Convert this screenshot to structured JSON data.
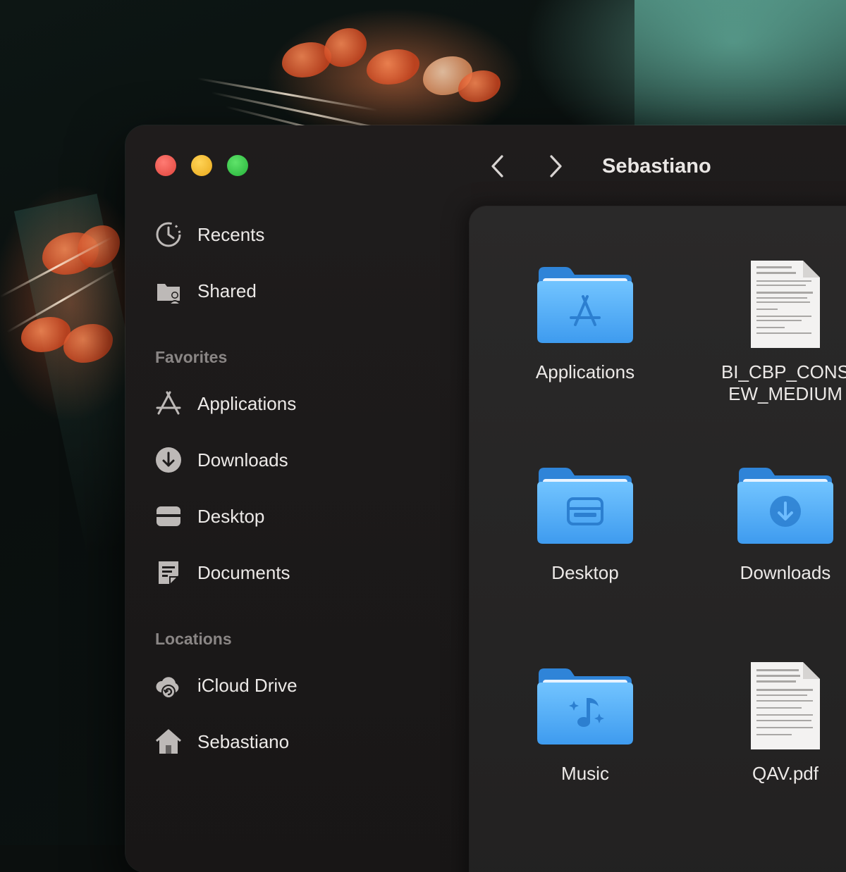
{
  "window": {
    "title": "Sebastiano",
    "nav_back_icon": "chevron-left-icon",
    "nav_forward_icon": "chevron-right-icon"
  },
  "sidebar": {
    "top_items": [
      {
        "label": "Recents",
        "icon": "clock-icon"
      },
      {
        "label": "Shared",
        "icon": "shared-folder-icon"
      }
    ],
    "favorites_header": "Favorites",
    "favorites": [
      {
        "label": "Applications",
        "icon": "app-store-icon"
      },
      {
        "label": "Downloads",
        "icon": "download-circle-icon"
      },
      {
        "label": "Desktop",
        "icon": "desktop-icon"
      },
      {
        "label": "Documents",
        "icon": "document-icon"
      }
    ],
    "locations_header": "Locations",
    "locations": [
      {
        "label": "iCloud Drive",
        "icon": "icloud-icon"
      },
      {
        "label": "Sebastiano",
        "icon": "home-icon"
      }
    ]
  },
  "files": [
    {
      "label": "Applications",
      "kind": "folder",
      "glyph": "app-store-icon"
    },
    {
      "label": "BI_CBP_CONS\nEW_MEDIUM",
      "kind": "document"
    },
    {
      "label": "Desktop",
      "kind": "folder",
      "glyph": "desktop-icon"
    },
    {
      "label": "Downloads",
      "kind": "folder",
      "glyph": "download-circle-icon"
    },
    {
      "label": "Music",
      "kind": "folder",
      "glyph": "music-note-icon"
    },
    {
      "label": "QAV.pdf",
      "kind": "document"
    }
  ],
  "colors": {
    "close": "#e0443c",
    "minimize": "#e9a91c",
    "zoom": "#26b33a",
    "folder": "#5ab4f5",
    "sidebar_text": "#ece9e7",
    "section_header": "#8a8685"
  }
}
